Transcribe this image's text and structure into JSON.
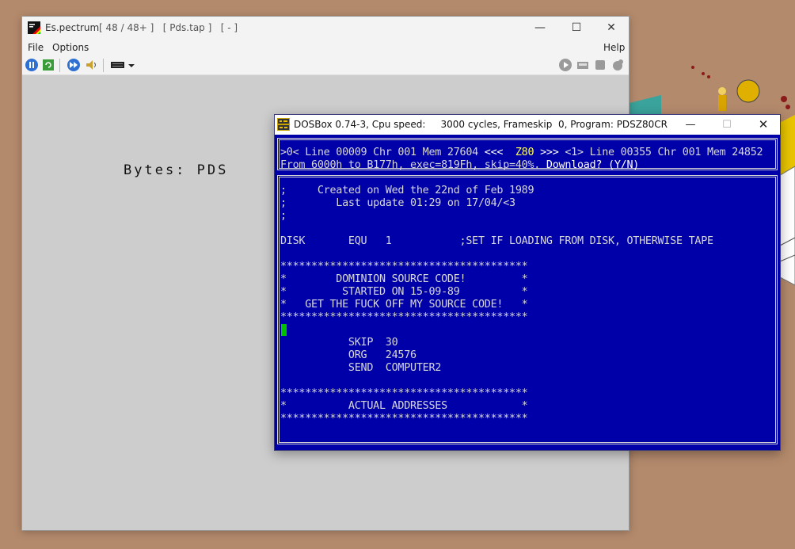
{
  "spectrum_window": {
    "app_name": "Es.pectrum",
    "status": "[ 48 / 48+ ]   [ Pds.tap ]   [ - ]",
    "menu": [
      "File",
      "Options",
      "Help"
    ],
    "screen_text": "Bytes: PDS",
    "icons": [
      "pause-icon",
      "reset-icon",
      "fast-forward-icon",
      "sound-icon",
      "keyboard-icon",
      "play-icon",
      "tape-icon",
      "stop-icon",
      "settings-icon"
    ]
  },
  "dosbox_window": {
    "title": "DOSBox 0.74-3, Cpu speed:     3000 cycles, Frameskip  0, Program: PDSZ80CR",
    "status_line_1": {
      "left": ">0< Line 00009 Chr 001 Mem 27604 ",
      "arrows_left": "<<<",
      "center": "Z80",
      "arrows_right": ">>>",
      "right": " <1> Line 00355 Chr 001 Mem 24852"
    },
    "status_line_2": {
      "text": "From 6000h to B177h, exec=819Fh, skip=40%. ",
      "prompt": "Download? (Y/N)"
    },
    "source_lines": [
      ";     Created on Wed the 22nd of Feb 1989",
      ";        Last update 01:29 on 17/04/<3",
      ";",
      "",
      "DISK       EQU   1           ;SET IF LOADING FROM DISK, OTHERWISE TAPE",
      "",
      "****************************************",
      "*        DOMINION SOURCE CODE!         *",
      "*         STARTED ON 15-09-89          *",
      "*   GET THE FUCK OFF MY SOURCE CODE!   *",
      "****************************************",
      "",
      "           SKIP  30",
      "           ORG   24576",
      "           SEND  COMPUTER2",
      "",
      "****************************************",
      "*          ACTUAL ADDRESSES            *",
      "****************************************"
    ]
  },
  "colors": {
    "dos_background": "#0000a8",
    "dos_text": "#d8d8d8",
    "cursor": "#00c000",
    "desktop": "#b48a6c"
  }
}
